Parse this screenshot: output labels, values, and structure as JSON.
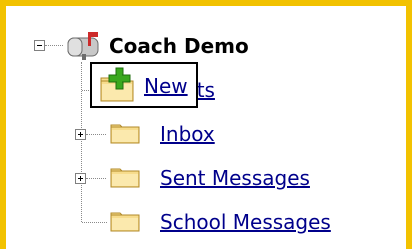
{
  "tree": {
    "root": {
      "label": "Coach Demo",
      "icon": "mailbox-icon"
    },
    "items": [
      {
        "label": "fts",
        "icon": "folder-icon"
      },
      {
        "label": "Inbox",
        "icon": "folder-icon",
        "expandable": true
      },
      {
        "label": "Sent Messages",
        "icon": "folder-icon",
        "expandable": true
      },
      {
        "label": "School Messages",
        "icon": "folder-icon"
      }
    ]
  },
  "drag_overlay": {
    "label": "New",
    "icon": "new-folder-icon"
  },
  "colors": {
    "frame_border": "#f2c200",
    "link": "#00008b",
    "folder_fill": "#f7dc8c",
    "plus_green": "#3aa81e"
  }
}
